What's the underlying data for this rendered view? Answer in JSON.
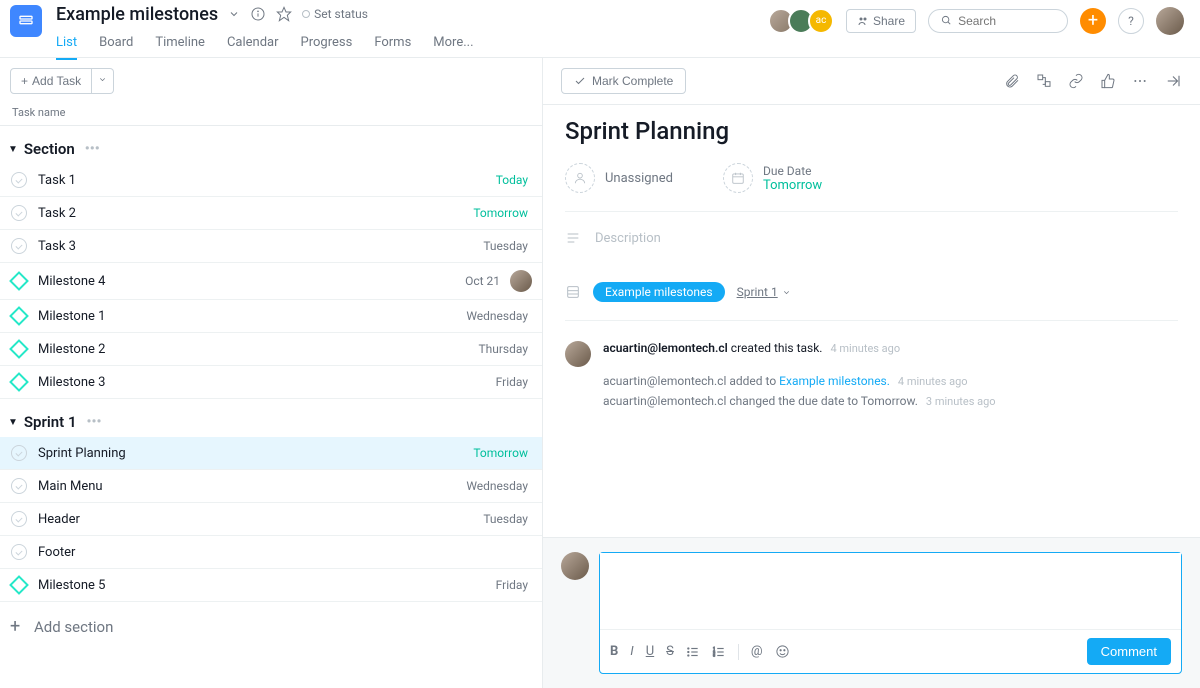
{
  "header": {
    "project_title": "Example milestones",
    "set_status": "Set status",
    "share": "Share",
    "search_placeholder": "Search",
    "tabs": [
      "List",
      "Board",
      "Timeline",
      "Calendar",
      "Progress",
      "Forms",
      "More..."
    ],
    "active_tab": 0,
    "avatar_initials": [
      "",
      "",
      "ac"
    ]
  },
  "left": {
    "add_task": "Add Task",
    "col_task": "Task name",
    "sections": [
      {
        "name": "Section",
        "rows": [
          {
            "type": "task",
            "name": "Task 1",
            "due": "Today",
            "due_green": true
          },
          {
            "type": "task",
            "name": "Task 2",
            "due": "Tomorrow",
            "due_green": true
          },
          {
            "type": "task",
            "name": "Task 3",
            "due": "Tuesday",
            "due_green": false
          },
          {
            "type": "milestone",
            "name": "Milestone 4",
            "due": "Oct 21",
            "assigned": true
          },
          {
            "type": "milestone",
            "name": "Milestone 1",
            "due": "Wednesday"
          },
          {
            "type": "milestone",
            "name": "Milestone 2",
            "due": "Thursday"
          },
          {
            "type": "milestone",
            "name": "Milestone 3",
            "due": "Friday"
          }
        ]
      },
      {
        "name": "Sprint 1",
        "rows": [
          {
            "type": "task",
            "name": "Sprint Planning",
            "due": "Tomorrow",
            "due_green": true,
            "selected": true
          },
          {
            "type": "task",
            "name": "Main Menu",
            "due": "Wednesday"
          },
          {
            "type": "task",
            "name": "Header",
            "due": "Tuesday"
          },
          {
            "type": "task",
            "name": "Footer",
            "due": ""
          },
          {
            "type": "milestone",
            "name": "Milestone 5",
            "due": "Friday"
          }
        ]
      }
    ],
    "add_section": "Add section"
  },
  "detail": {
    "mark_complete": "Mark Complete",
    "title": "Sprint Planning",
    "unassigned": "Unassigned",
    "due_label": "Due Date",
    "due_value": "Tomorrow",
    "description": "Description",
    "project_pill": "Example milestones",
    "project_section": "Sprint 1",
    "created": {
      "user": "acuartin@lemontech.cl",
      "text": "created this task.",
      "ts": "4 minutes ago"
    },
    "log1": {
      "user": "acuartin@lemontech.cl",
      "text": "added to",
      "link": "Example milestones.",
      "ts": "4 minutes ago"
    },
    "log2": {
      "user": "acuartin@lemontech.cl",
      "text": "changed the due date to Tomorrow.",
      "ts": "3 minutes ago"
    },
    "comment_btn": "Comment"
  }
}
